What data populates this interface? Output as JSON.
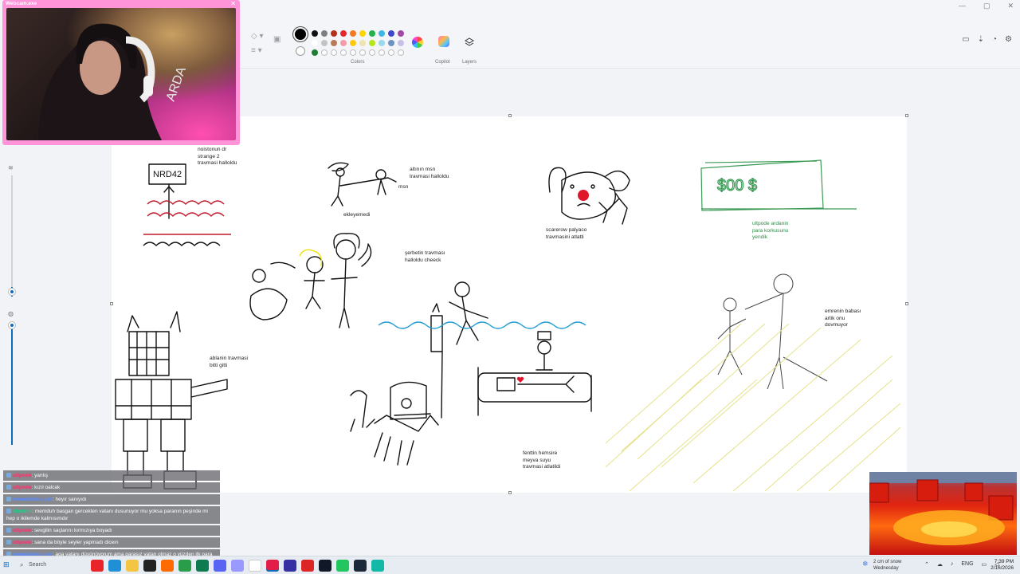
{
  "window": {
    "controls": [
      "—",
      "▢",
      "✕"
    ]
  },
  "ribbon": {
    "colors_label": "Colors",
    "copilot_label": "Copilot",
    "layers_label": "Layers",
    "current_primary": "#000000",
    "current_secondary": "#ffffff",
    "palette": [
      "#111111",
      "#7f7f7f",
      "#b5301c",
      "#e4262e",
      "#f47a20",
      "#ffd400",
      "#22b14c",
      "#3fb6e6",
      "#3f48cc",
      "#a349a4",
      "#ffffff",
      "#c3c3c3",
      "#b97a57",
      "#f59aa8",
      "#ffc90e",
      "#efe4b0",
      "#b5e61d",
      "#99d9ea",
      "#7092be",
      "#c8bfe7",
      "#1e7d32",
      "empty",
      "empty",
      "empty",
      "empty",
      "empty",
      "empty",
      "empty",
      "empty",
      "empty"
    ]
  },
  "webcam": {
    "title": "Webcam.exe",
    "close": "✕"
  },
  "canvas": {
    "notes": [
      {
        "id": "note-noistonun",
        "text": "noistonun dr\nstrange 2\ntravmasi halloldu",
        "green": false
      },
      {
        "id": "note-altinin-msn",
        "text": "altının msn\ntravmasi halloldu",
        "green": false
      },
      {
        "id": "note-msn",
        "text": "msn",
        "green": false
      },
      {
        "id": "note-ekleyemedi",
        "text": "ekleyemedi",
        "green": false
      },
      {
        "id": "note-scarerow",
        "text": "scarerow palyaco\ntravmasini atlatti",
        "green": false
      },
      {
        "id": "note-ultpode",
        "text": "ultpode ardanin\npara korkusunu\nyendik",
        "green": true
      },
      {
        "id": "note-serbetin",
        "text": "şerbetin travması\nhalloldu cheeck",
        "green": false
      },
      {
        "id": "note-emrenin",
        "text": "emrenin babası\nartik onu\ndovmuyor",
        "green": false
      },
      {
        "id": "note-ablanin",
        "text": "ablanin travmasi\nbitti gitti",
        "green": false
      },
      {
        "id": "note-fenttin",
        "text": "fenttin hemsire\nmeyva suyu\ntravmasi atlatildi",
        "green": false
      }
    ]
  },
  "chat": [
    {
      "user": "ultpode",
      "text": "yanlış",
      "user_color": "#ff2f6d"
    },
    {
      "user": "ultpode",
      "text": "kızıl oalcak",
      "user_color": "#ff2f6d"
    },
    {
      "user": "memduhbasgan",
      "text": "heyır sanıyıdı",
      "user_color": "#5b8cff"
    },
    {
      "user": "sbetelik",
      "text": "memduh basgan gercekten vatanı dusunuyor mu yoksa paranın peşinde mi hep o ikilemde kalmısımdır",
      "user_color": "#22cc88"
    },
    {
      "user": "ultpode",
      "text": "sevgilin saçlarını kırmızıya boyadı",
      "user_color": "#ff2f6d"
    },
    {
      "user": "ultpode",
      "text": "sana da böyle seyler yapmadı diceın",
      "user_color": "#ff2f6d"
    },
    {
      "user": "memduhbasgan",
      "text": "aga vatanı düşünüyprum ama parasız vatan olmaz o yüzden ilk para sonra vatan",
      "user_color": "#5b8cff"
    }
  ],
  "taskbar": {
    "search_placeholder": "Search",
    "weather_line1": "2 cm of snow",
    "weather_line2": "Wednesday",
    "lang": "ENG",
    "time": "7:39 PM",
    "date": "2/16/2026"
  }
}
